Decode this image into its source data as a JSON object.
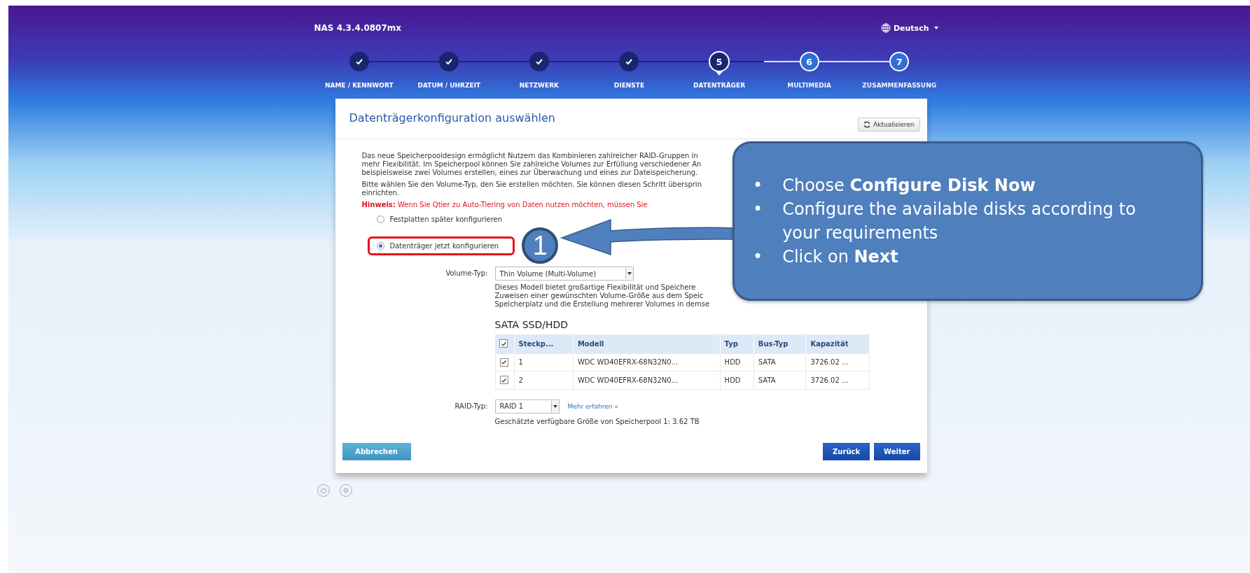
{
  "header": {
    "version": "NAS 4.3.4.0807mx",
    "language": "Deutsch"
  },
  "steps": [
    {
      "label": "NAME / KENNWORT",
      "done": true,
      "selected": false
    },
    {
      "label": "DATUM / UHRZEIT",
      "done": true,
      "selected": false
    },
    {
      "label": "NETZWERK",
      "done": true,
      "selected": false
    },
    {
      "label": "DIENSTE",
      "done": true,
      "selected": false
    },
    {
      "label": "DATENTRÄGER",
      "done": false,
      "selected": true,
      "number": "5"
    },
    {
      "label": "MULTIMEDIA",
      "done": false,
      "selected": false,
      "number": "6"
    },
    {
      "label": "ZUSAMMENFASSUNG",
      "done": false,
      "selected": false,
      "number": "7"
    }
  ],
  "dialog": {
    "title": "Datenträgerkonfiguration auswählen",
    "refresh_button": "Aktualisieren",
    "intro_lines": [
      "Das neue Speicherpooldesign ermöglicht Nutzern das Kombinieren zahlreicher RAID-Gruppen in",
      "mehr Flexibilität. Im Speicherpool können Sie zahlreiche Volumes zur Erfüllung verschiedener An",
      "beispielsweise zwei Volumes erstellen, eines zur Überwachung und eines zur Dateispeicherung."
    ],
    "prompt_lines": [
      "Bitte wählen Sie den Volume-Typ, den Sie erstellen möchten. Sie können diesen Schritt übersprin",
      "einrichten."
    ],
    "hint": "**Hinweis:** Wenn Sie Qtier zu Auto-Tiering von Daten nutzen möchten, müssen Sie",
    "options": [
      {
        "label": "Festplatten später konfigurieren",
        "selected": false,
        "highlighted": false
      },
      {
        "label": "Datenträger jetzt konfigurieren",
        "selected": true,
        "highlighted": true,
        "marker": "1"
      }
    ],
    "volume_type": {
      "label": "Volume-Typ:",
      "value": "Thin Volume (Multi-Volume)"
    },
    "description_lines": [
      "Dieses Modell bietet großartige Flexibilität und Speichere",
      "Zuweisen einer gewünschten Volume-Größe aus dem Speic",
      "Speicherplatz und die Erstellung mehrerer Volumes in demse"
    ],
    "disk_table": {
      "title": "SATA SSD/HDD",
      "header_checked": true,
      "columns": [
        "Steckp...",
        "Modell",
        "Typ",
        "Bus-Typ",
        "Kapazität"
      ],
      "rows": [
        {
          "checked": true,
          "cells": [
            "1",
            "WDC WD40EFRX-68N32N0...",
            "HDD",
            "SATA",
            "3726.02 ..."
          ]
        },
        {
          "checked": true,
          "cells": [
            "2",
            "WDC WD40EFRX-68N32N0...",
            "HDD",
            "SATA",
            "3726.02 ..."
          ]
        }
      ]
    },
    "raid_type": {
      "label": "RAID-Typ:",
      "value": "RAID 1",
      "link": "Mehr erfahren »"
    },
    "estimate": "Geschätzte verfügbare Größe von Speicherpool 1: 3.62 TB",
    "buttons": {
      "cancel": "Abbrechen",
      "back": "Zurück",
      "next": "Weiter"
    }
  },
  "callout": {
    "bullet": "•",
    "items": [
      "Choose **Configure Disk Now**",
      "Configure the available disks according to your requirements",
      "Click on **Next**"
    ]
  }
}
